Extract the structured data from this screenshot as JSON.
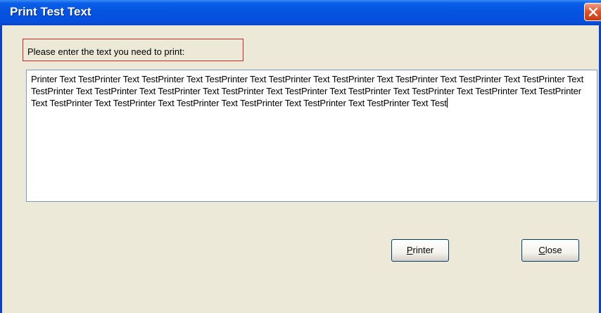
{
  "window": {
    "title": "Print Test Text"
  },
  "prompt": {
    "label": "Please enter the text you need to print:"
  },
  "textarea": {
    "value": "Printer Text TestPrinter Text TestPrinter Text TestPrinter Text TestPrinter Text TestPrinter Text TestPrinter Text TestPrinter Text TestPrinter Text TestPrinter Text TestPrinter Text TestPrinter Text TestPrinter Text TestPrinter Text TestPrinter Text TestPrinter Text TestPrinter Text TestPrinter Text TestPrinter Text TestPrinter Text TestPrinter Text TestPrinter Text TestPrinter Text TestPrinter Text Test"
  },
  "buttons": {
    "printer": {
      "mnemonic": "P",
      "rest": "rinter"
    },
    "close": {
      "mnemonic": "C",
      "rest": "lose"
    }
  },
  "icons": {
    "close": "close-icon"
  },
  "colors": {
    "titlebar": "#0553df",
    "window_bg": "#ece9d8",
    "highlight_border": "#e02424"
  }
}
